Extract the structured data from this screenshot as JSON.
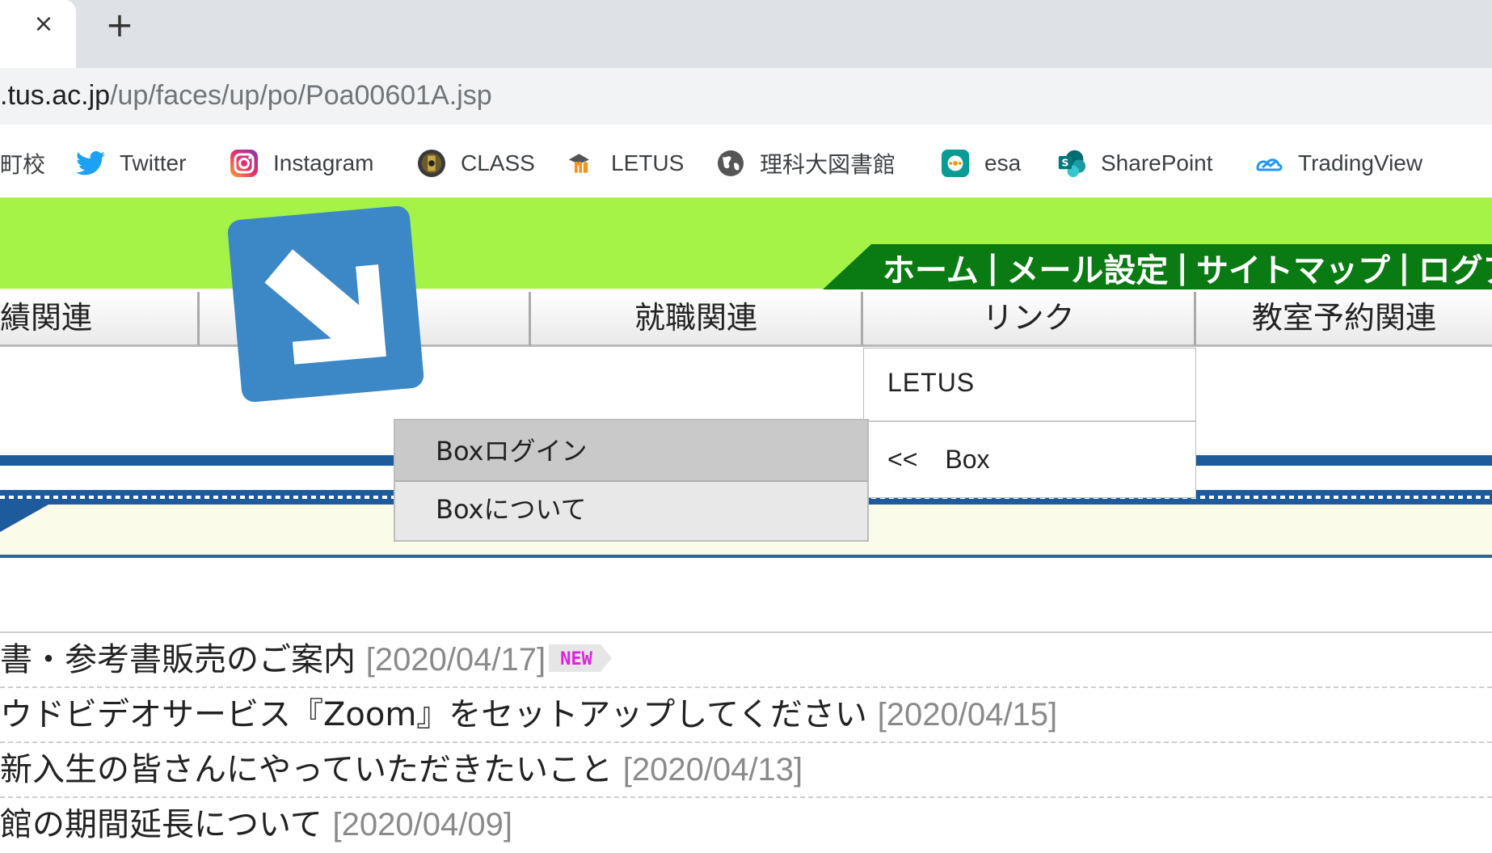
{
  "browser": {
    "close_tab_glyph": "×",
    "new_tab_glyph": "+",
    "url_host": ".tus.ac.jp",
    "url_path": "/up/faces/up/po/Poa00601A.jsp"
  },
  "bookmarks": [
    {
      "label": "町校",
      "icon": "partial"
    },
    {
      "label": "Twitter",
      "icon": "twitter-icon"
    },
    {
      "label": "Instagram",
      "icon": "instagram-icon"
    },
    {
      "label": "CLASS",
      "icon": "class-icon"
    },
    {
      "label": "LETUS",
      "icon": "moodle-icon"
    },
    {
      "label": "理科大図書館",
      "icon": "globe-icon"
    },
    {
      "label": "esa",
      "icon": "esa-icon"
    },
    {
      "label": "SharePoint",
      "icon": "sharepoint-icon"
    },
    {
      "label": "TradingView",
      "icon": "tradingview-icon"
    }
  ],
  "top_nav": {
    "home": "ホーム",
    "mail": "メール設定",
    "sitemap": "サイトマップ",
    "logout": "ログアウ",
    "separator": "|"
  },
  "menu_bar": [
    "績関連",
    "",
    "就職関連",
    "リンク",
    "教室予約関連"
  ],
  "link_menu": {
    "letus": "LETUS",
    "box_arrow": "<<",
    "box": "Box"
  },
  "box_submenu": {
    "login": "Boxログイン",
    "about": "Boxについて"
  },
  "news": [
    {
      "title": "書・参考書販売のご案内 ",
      "date": "[2020/04/17]",
      "badge": "NEW"
    },
    {
      "title": "ウドビデオサービス『Zoom』をセットアップしてください ",
      "date": "[2020/04/15]"
    },
    {
      "title": "新入生の皆さんにやっていただきたいこと ",
      "date": "[2020/04/13]"
    },
    {
      "title": "館の期間延長について ",
      "date": "[2020/04/09]"
    }
  ],
  "colors": {
    "header_green": "#a4f346",
    "nav_dark_green": "#0a7a12",
    "rule_blue": "#1e5b9c",
    "arrow_tile_blue": "#3c87c6",
    "new_badge_magenta": "#e020e0"
  }
}
